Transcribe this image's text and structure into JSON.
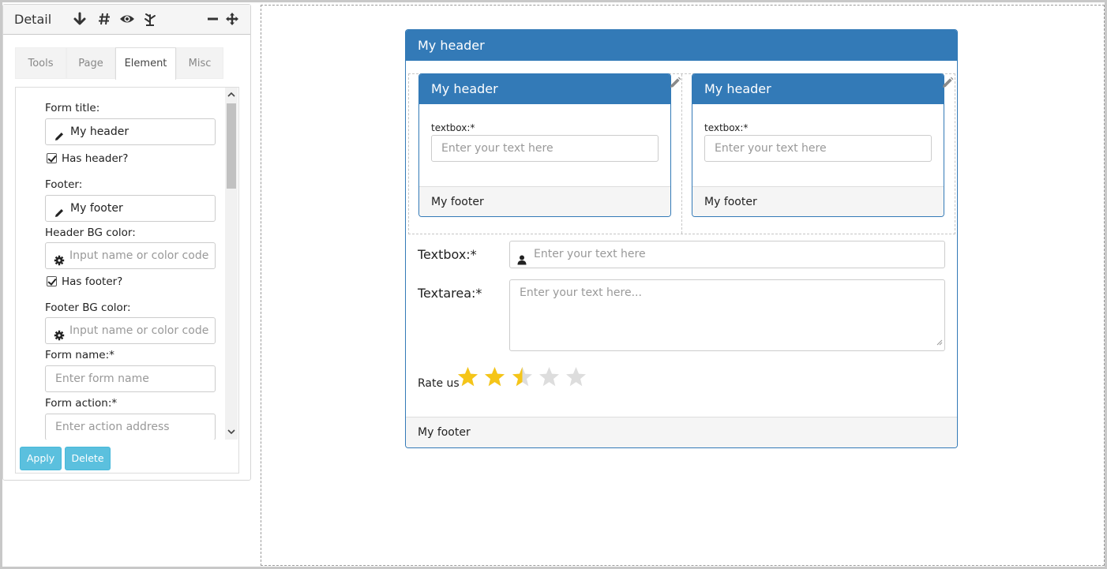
{
  "panel": {
    "title": "Detail",
    "header_icons": [
      "arrow-down-icon",
      "hash-icon",
      "eye-icon",
      "tree-icon",
      "minus-icon",
      "move-icon"
    ],
    "tabs": [
      {
        "label": "Tools"
      },
      {
        "label": "Page"
      },
      {
        "label": "Element",
        "active": true
      },
      {
        "label": "Misc"
      }
    ],
    "form": {
      "form_title_label": "Form title:",
      "form_title_value": "My header",
      "has_header_label": "Has header?",
      "has_header_checked": true,
      "footer_label": "Footer:",
      "footer_value": "My footer",
      "header_bg_label": "Header BG color:",
      "header_bg_placeholder": "Input name or color code",
      "has_footer_label": "Has footer?",
      "has_footer_checked": true,
      "footer_bg_label": "Footer BG color:",
      "footer_bg_placeholder": "Input name or color code",
      "form_name_label": "Form name:*",
      "form_name_placeholder": "Enter form name",
      "form_action_label": "Form action:*",
      "form_action_placeholder": "Enter action address"
    },
    "buttons": {
      "apply": "Apply",
      "delete": "Delete"
    }
  },
  "canvas": {
    "main_form": {
      "header": "My header",
      "footer": "My footer",
      "subforms": [
        {
          "header": "My header",
          "field_label": "textbox:*",
          "placeholder": "Enter your text here",
          "footer": "My footer"
        },
        {
          "header": "My header",
          "field_label": "textbox:*",
          "placeholder": "Enter your text here",
          "footer": "My footer"
        }
      ],
      "textbox_label": "Textbox:*",
      "textbox_placeholder": "Enter your text here",
      "textarea_label": "Textarea:*",
      "textarea_placeholder": "Enter your text here...",
      "rating_label": "Rate us",
      "rating_value": 2.5,
      "rating_max": 5
    }
  },
  "colors": {
    "header_blue": "#337ab7",
    "button_blue": "#5bc0de",
    "star_gold": "#f5c518",
    "star_gray": "#dddddd"
  }
}
